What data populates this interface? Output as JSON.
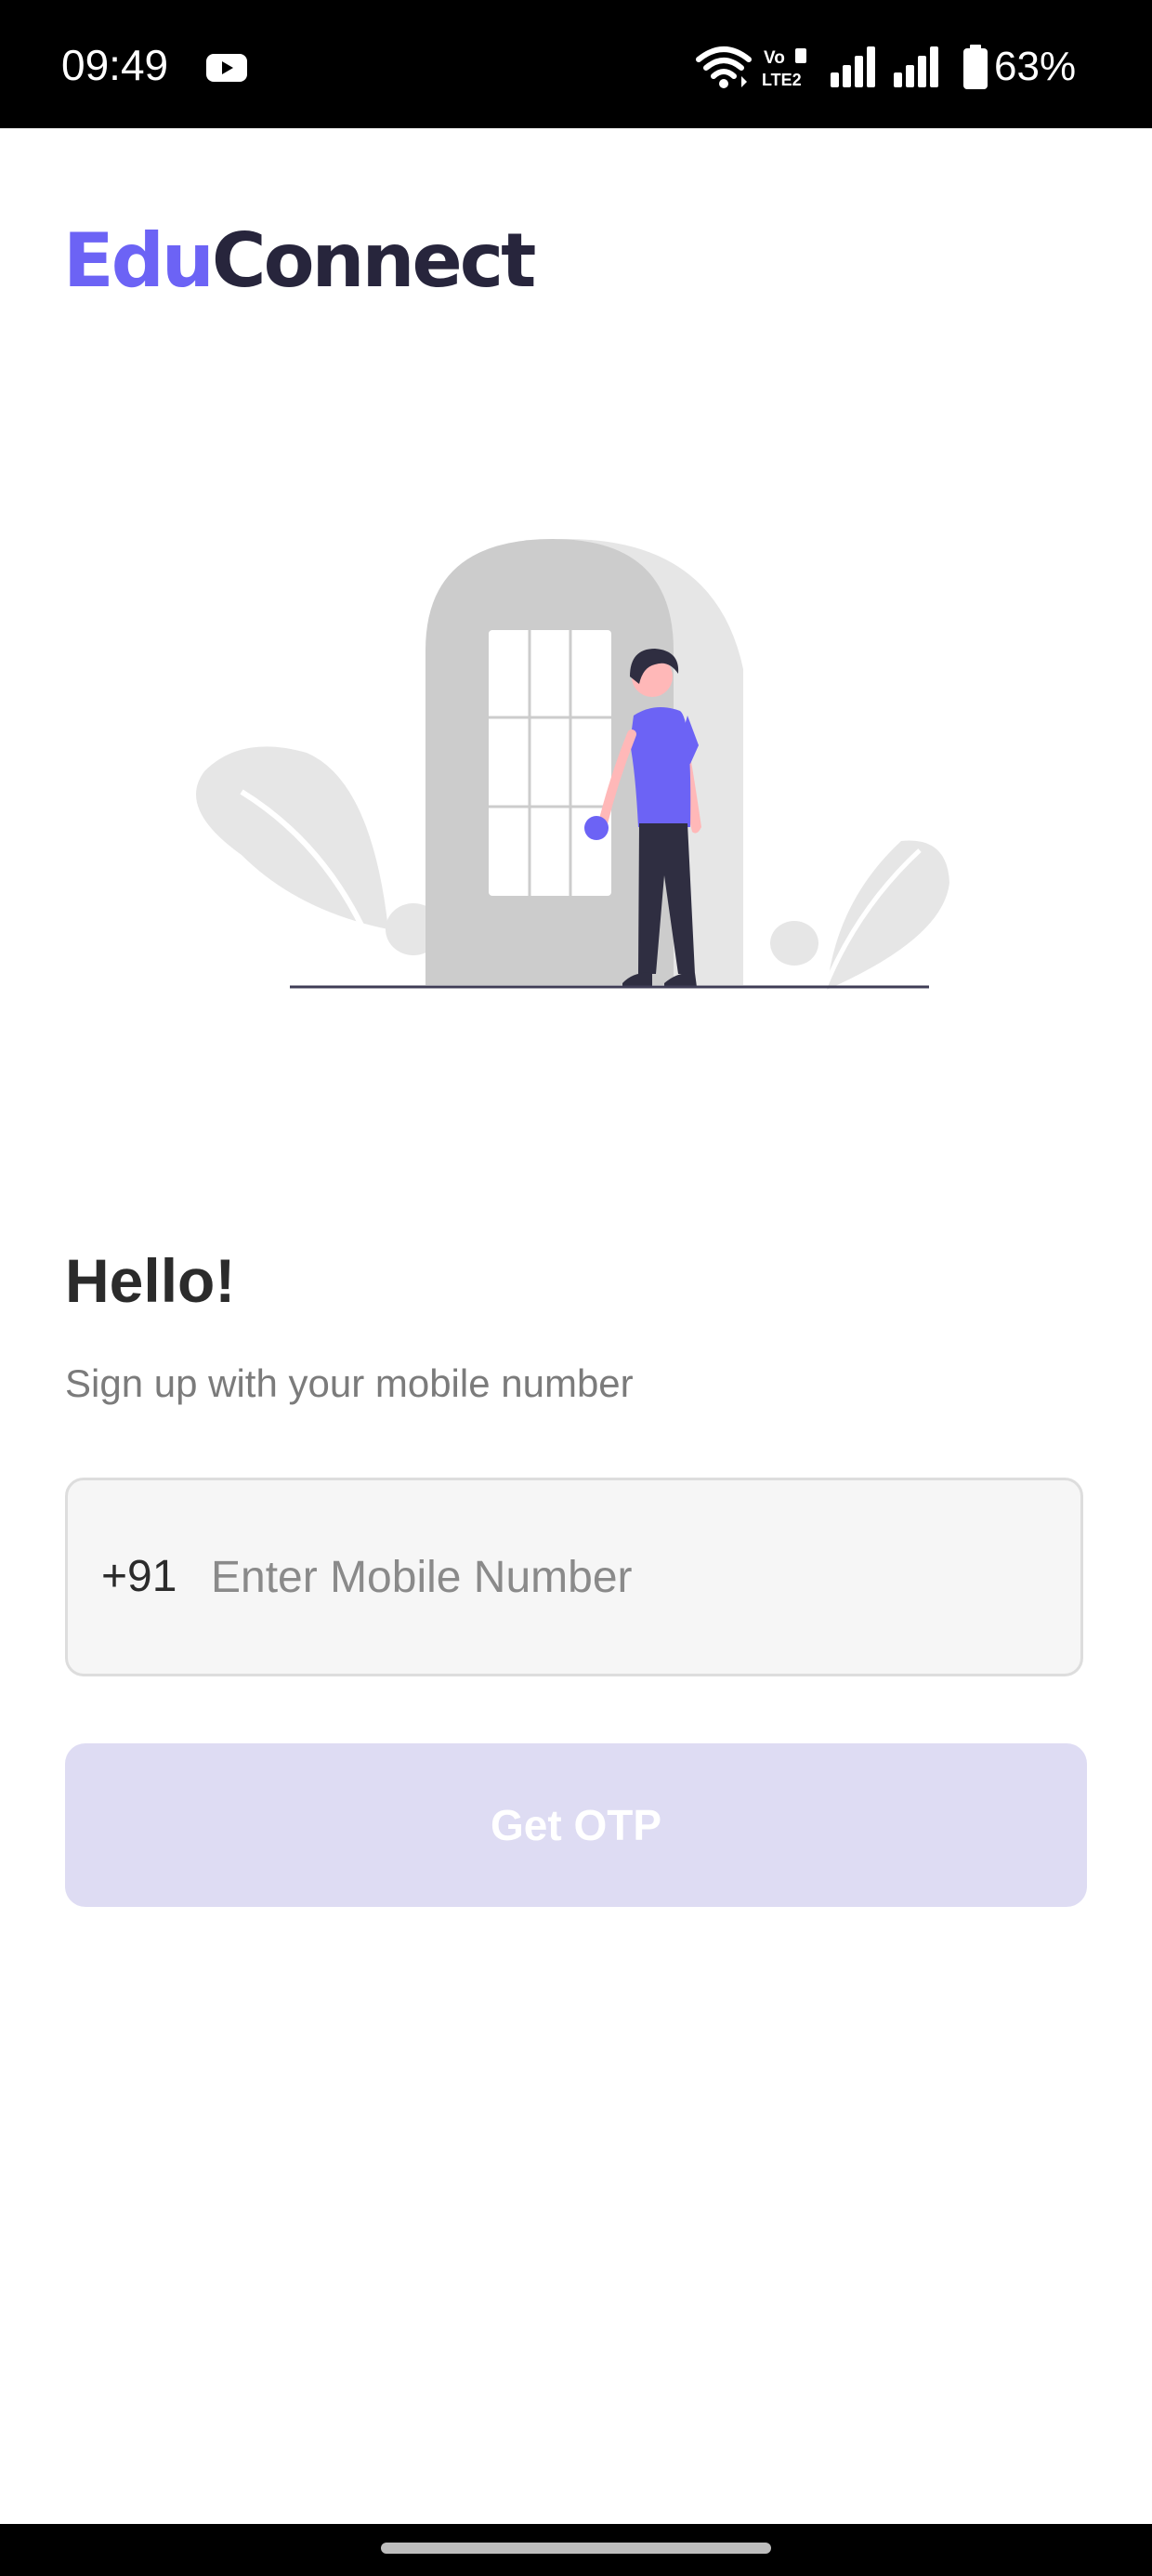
{
  "status_bar": {
    "time": "09:49",
    "battery": "63%",
    "icons": [
      "youtube-icon",
      "wifi-icon",
      "volte-icon",
      "signal-icon",
      "signal-icon",
      "battery-icon"
    ]
  },
  "logo": {
    "part1": "Edu",
    "part2": "Connect"
  },
  "greeting": {
    "title": "Hello!",
    "subtitle": "Sign up with your mobile number"
  },
  "mobile_field": {
    "country_code": "+91",
    "placeholder": "Enter Mobile Number",
    "value": ""
  },
  "button": {
    "label": "Get OTP"
  },
  "colors": {
    "brand": "#6c63f5",
    "brand_dark": "#27253c",
    "button_disabled": "#dedcf3"
  }
}
